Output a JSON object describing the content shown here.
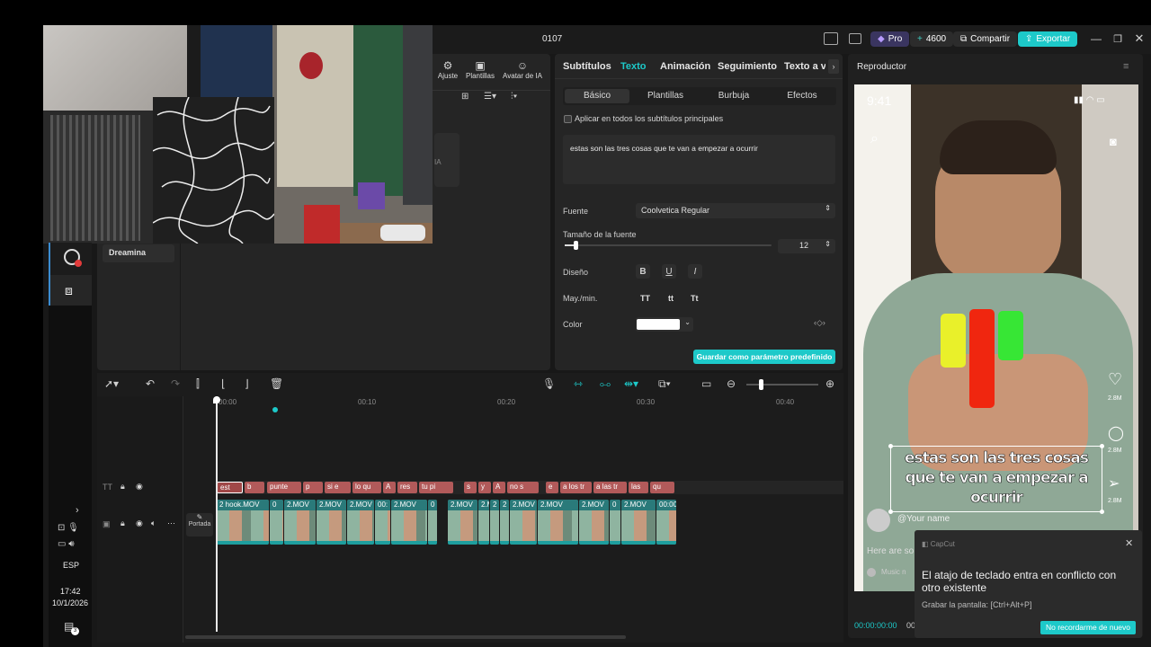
{
  "window": {
    "title": "0107"
  },
  "header": {
    "pro_label": "Pro",
    "credits": "4600",
    "share_label": "Compartir",
    "export_label": "Exportar"
  },
  "toolbar_top": {
    "ajuste_label": "Ajuste",
    "plantillas_label": "Plantillas",
    "avatar_label": "Avatar de IA",
    "ia_label": "IA"
  },
  "left_panel": {
    "dreamina_label": "Dreamina"
  },
  "props": {
    "tabs": [
      "Subtítulos",
      "Texto",
      "Animación",
      "Seguimiento",
      "Texto a voz"
    ],
    "subtabs": [
      "Básico",
      "Plantillas",
      "Burbuja",
      "Efectos"
    ],
    "apply_all": "Aplicar en todos los subtítulos principales",
    "text_value": "estas son las tres cosas que te van a empezar a ocurrir",
    "font_label": "Fuente",
    "font_value": "Coolvetica Regular",
    "size_label": "Tamaño de la fuente",
    "size_value": "12",
    "size_level": 0.05,
    "design_label": "Diseño",
    "case_label": "May./min.",
    "case_opts": [
      "TT",
      "tt",
      "Tt"
    ],
    "color_label": "Color",
    "color_value": "#ffffff",
    "save_preset": "Guardar como parámetro predefinido"
  },
  "player": {
    "title": "Reproductor",
    "time_current": "00:00:00:00",
    "time_total": "00",
    "phone_time": "9:41",
    "caption": "estas son las tres cosas que te van a empezar a ocurrir",
    "likes": [
      "2.8M",
      "2.8M",
      "2.8M"
    ],
    "username": "@Your name",
    "desc": "Here are so",
    "music": "Music n"
  },
  "toast": {
    "app": "CapCut",
    "title": "El atajo de teclado entra en conflicto con otro existente",
    "detail": "Grabar la pantalla: [Ctrl+Alt+P]",
    "button": "No recordarme de nuevo"
  },
  "timeline": {
    "ruler": [
      "00:00",
      "00:10",
      "00:20",
      "00:30",
      "00:40"
    ],
    "cover_label": "Portada",
    "text_clips": [
      "est",
      "b",
      "punte",
      "p",
      "si e",
      "lo qu",
      "A",
      "res",
      "tu pi",
      "s",
      "y",
      "A",
      "no s",
      "e",
      "a los tr",
      "a las tr",
      "las",
      "qu"
    ],
    "video_clips": [
      "2 hook.MOV",
      "0",
      "2.MOV",
      "2.MOV",
      "2.MOV",
      "00:",
      "2.MOV",
      "0",
      "2.MOV",
      "2.M",
      "2",
      "2",
      "2.MOV",
      "2.MOV",
      "2.MOV",
      "0",
      "2.MOV",
      "00:00"
    ]
  },
  "taskbar": {
    "lang": "ESP",
    "time": "17:42",
    "date": "10/1/2026",
    "notif": "3"
  },
  "colors": {
    "accent": "#1dc9c9",
    "text_clip": "#b25a5a",
    "video_clip": "#2a7a7a"
  }
}
